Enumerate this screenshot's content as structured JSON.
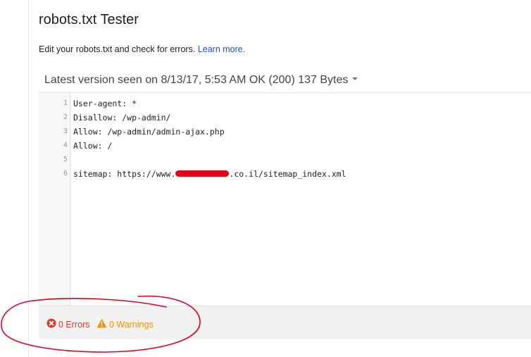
{
  "header": {
    "title": "robots.txt Tester",
    "description": "Edit your robots.txt and check for errors.",
    "learn_more": "Learn more."
  },
  "version": {
    "text": "Latest version seen on 8/13/17, 5:53 AM OK (200) 137 Bytes"
  },
  "editor": {
    "lines": [
      {
        "num": "1",
        "text": "User-agent: *"
      },
      {
        "num": "2",
        "text": "Disallow: /wp-admin/"
      },
      {
        "num": "3",
        "text": "Allow: /wp-admin/admin-ajax.php"
      },
      {
        "num": "4",
        "text": "Allow: /"
      },
      {
        "num": "5",
        "text": ""
      },
      {
        "num": "6",
        "text_before": "sitemap: https://www.",
        "text_after": ".co.il/sitemap_index.xml"
      }
    ]
  },
  "footer": {
    "errors": "0 Errors",
    "warnings": "0 Warnings"
  },
  "colors": {
    "error": "#d23f31",
    "warning": "#f09300",
    "link": "#1155cc",
    "annotation": "#e3001b"
  },
  "icons": {
    "errors": "error-circle-icon",
    "warnings": "warning-triangle-icon",
    "dropdown": "caret-down-icon"
  }
}
